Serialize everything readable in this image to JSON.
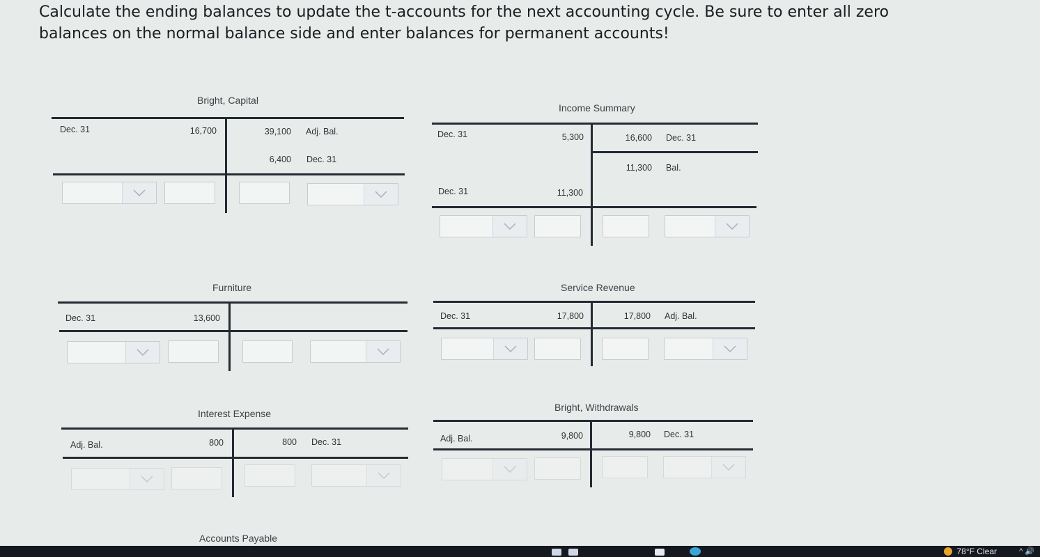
{
  "instructions": "Calculate the ending balances to update the t-accounts for the next accounting cycle. Be sure to enter all zero balances on the normal balance side and enter balances for permanent accounts!",
  "accounts": {
    "capital": {
      "title": "Bright, Capital",
      "debit": [
        {
          "label": "Dec. 31",
          "amount": "16,700"
        }
      ],
      "credit": [
        {
          "amount": "39,100",
          "label": "Adj. Bal."
        },
        {
          "amount": "6,400",
          "label": "Dec. 31"
        }
      ]
    },
    "income_summary": {
      "title": "Income Summary",
      "debit": [
        {
          "label": "Dec. 31",
          "amount": "5,300"
        },
        {
          "label": "Dec. 31",
          "amount": "11,300"
        }
      ],
      "credit": [
        {
          "amount": "16,600",
          "label": "Dec. 31"
        },
        {
          "amount": "11,300",
          "label": "Bal."
        }
      ]
    },
    "furniture": {
      "title": "Furniture",
      "debit": [
        {
          "label": "Dec. 31",
          "amount": "13,600"
        }
      ]
    },
    "service_revenue": {
      "title": "Service Revenue",
      "debit": [
        {
          "label": "Dec. 31",
          "amount": "17,800"
        }
      ],
      "credit": [
        {
          "amount": "17,800",
          "label": "Adj. Bal."
        }
      ]
    },
    "interest_expense": {
      "title": "Interest Expense",
      "debit": [
        {
          "label": "Adj. Bal.",
          "amount": "800"
        }
      ],
      "credit": [
        {
          "amount": "800",
          "label": "Dec. 31"
        }
      ]
    },
    "withdrawals": {
      "title": "Bright, Withdrawals",
      "debit": [
        {
          "label": "Adj. Bal.",
          "amount": "9,800"
        }
      ],
      "credit": [
        {
          "amount": "9,800",
          "label": "Dec. 31"
        }
      ]
    },
    "accounts_payable": {
      "title": "Accounts Payable"
    }
  },
  "taskbar": {
    "weather": "78°F  Clear",
    "icons": "^ 🔊"
  }
}
